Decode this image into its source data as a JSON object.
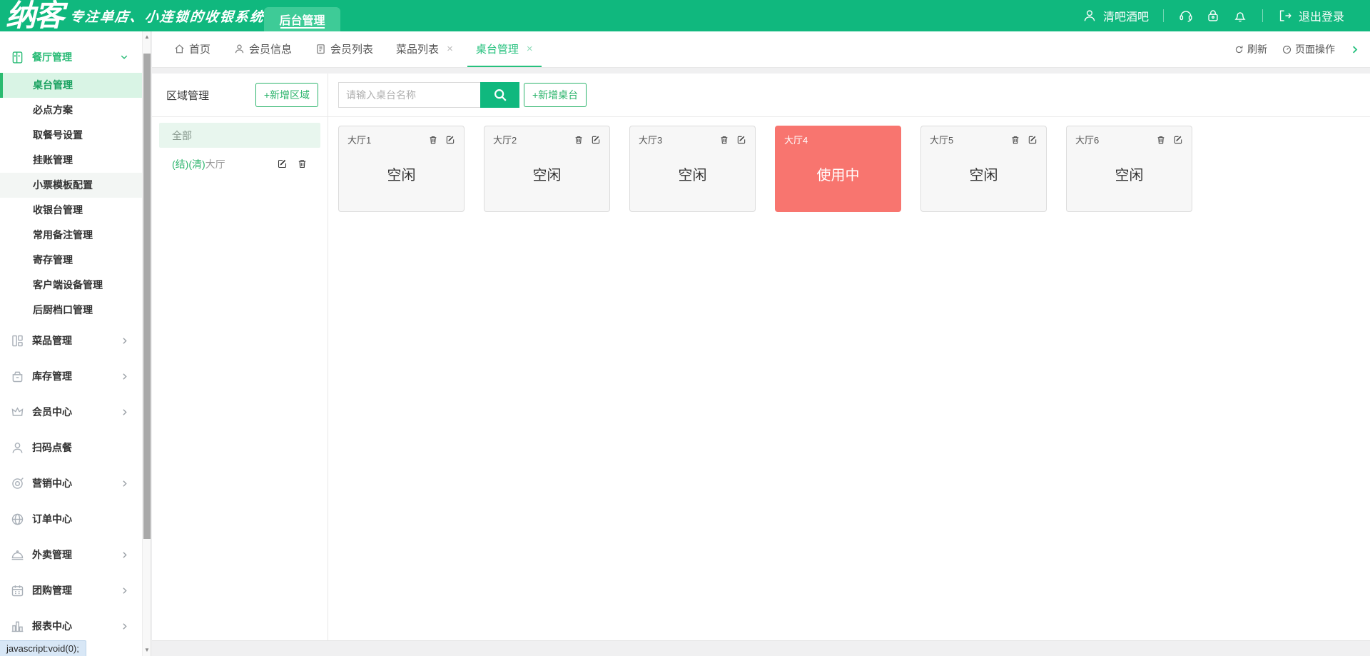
{
  "brand": {
    "logo": "纳客",
    "tagline": "专注单店、小连锁的收银系统"
  },
  "topbar": {
    "nav_tab": "后台管理",
    "user_name": "清吧酒吧",
    "logout_label": "退出登录"
  },
  "tabbar": {
    "tabs": [
      {
        "label": "首页",
        "icon": "home-icon",
        "closable": false,
        "active": false
      },
      {
        "label": "会员信息",
        "icon": "user-icon",
        "closable": false,
        "active": false
      },
      {
        "label": "会员列表",
        "icon": "clipboard-icon",
        "closable": false,
        "active": false
      },
      {
        "label": "菜品列表",
        "icon": null,
        "closable": true,
        "active": false
      },
      {
        "label": "桌台管理",
        "icon": null,
        "closable": true,
        "active": true
      }
    ],
    "close_symbol": "×",
    "refresh_label": "刷新",
    "page_actions_label": "页面操作"
  },
  "sidebar": {
    "groups": [
      {
        "label": "餐厅管理",
        "expanded": true
      },
      {
        "label": "菜品管理",
        "expandable": true
      },
      {
        "label": "库存管理",
        "expandable": true
      },
      {
        "label": "会员中心",
        "expandable": true
      },
      {
        "label": "扫码点餐",
        "expandable": false
      },
      {
        "label": "营销中心",
        "expandable": true
      },
      {
        "label": "订单中心",
        "expandable": false
      },
      {
        "label": "外卖管理",
        "expandable": true
      },
      {
        "label": "团购管理",
        "expandable": true
      },
      {
        "label": "报表中心",
        "expandable": true
      }
    ],
    "restaurant_submenu": [
      "桌台管理",
      "必点方案",
      "取餐号设置",
      "挂账管理",
      "小票模板配置",
      "收银台管理",
      "常用备注管理",
      "寄存管理",
      "客户端设备管理",
      "后厨档口管理"
    ],
    "active_item": "桌台管理"
  },
  "region_panel": {
    "title": "区域管理",
    "add_button": "+新增区域",
    "items": [
      {
        "prefix": "",
        "name": "全部",
        "selected": true
      },
      {
        "prefix": "(结)(清)",
        "name": "大厅",
        "selected": false
      }
    ]
  },
  "table_panel": {
    "search_placeholder": "请输入桌台名称",
    "add_button": "+新增桌台",
    "tables": [
      {
        "name": "大厅1",
        "status": "空闲",
        "in_use": false
      },
      {
        "name": "大厅2",
        "status": "空闲",
        "in_use": false
      },
      {
        "name": "大厅3",
        "status": "空闲",
        "in_use": false
      },
      {
        "name": "大厅4",
        "status": "使用中",
        "in_use": true
      },
      {
        "name": "大厅5",
        "status": "空闲",
        "in_use": false
      },
      {
        "name": "大厅6",
        "status": "空闲",
        "in_use": false
      }
    ]
  },
  "statusbar": {
    "link_hint": "javascript:void(0);"
  },
  "icons": {
    "user": "person outline",
    "headset": "headset outline",
    "lock": "padlock outline",
    "bell": "bell outline",
    "logout": "door-arrow",
    "home": "house outline",
    "clipboard": "list board",
    "refresh": "circular arrow",
    "page_actions": "gauge dial",
    "chevron_right": "›",
    "chevron_down": "⌄",
    "trash": "garbage can",
    "edit": "pen square",
    "search": "magnifier",
    "plus": "+"
  },
  "colors": {
    "topbar_green": "#10b87e",
    "topbar_tab_green": "#3ecb97",
    "accent_green": "#2cb46c",
    "active_tab_green": "#26c17e",
    "sidebar_active_bg": "#d9f4e5",
    "busy_red": "#f8756f",
    "card_bg": "#f7f7f7",
    "status_tip_bg": "#d8e7f6"
  }
}
